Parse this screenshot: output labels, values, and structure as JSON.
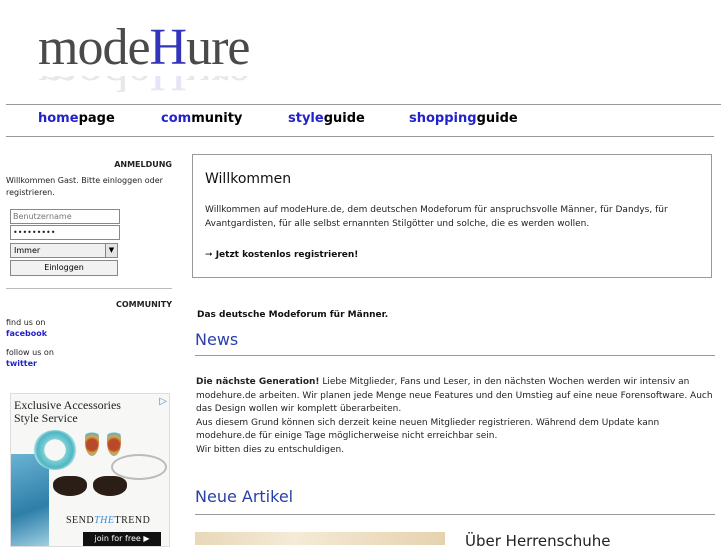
{
  "logo": {
    "pre": "mode",
    "accent": "H",
    "post": "ure"
  },
  "nav": [
    {
      "hl": "home",
      "rest": "page"
    },
    {
      "hl": "com",
      "rest": "munity"
    },
    {
      "hl": "style",
      "rest": "guide"
    },
    {
      "hl": "shopping",
      "rest": "guide"
    }
  ],
  "sidebar": {
    "login_title": "ANMELDUNG",
    "welcome_pre": "Willkommen Gast. Bitte ",
    "login_link": "einloggen",
    "welcome_mid": " oder ",
    "register_link": "registrieren",
    "welcome_post": ".",
    "username_placeholder": "Benutzername",
    "password_value": "•••••••••",
    "remember_value": "Immer",
    "login_button": "Einloggen",
    "community_title": "COMMUNITY",
    "find_us_label": "find us on",
    "facebook_link": "facebook",
    "follow_us_label": "follow us on",
    "twitter_link": "twitter"
  },
  "ad": {
    "title_line1": "Exclusive Accessories",
    "title_line2": "Style Service",
    "choices_icon": "adchoices-icon",
    "brand_pre": "SEND",
    "brand_em": "THE",
    "brand_post": "TREND",
    "join_label": "join for free ▶"
  },
  "welcome": {
    "heading": "Willkommen",
    "text": "Willkommen auf modeHure.de, dem deutschen Modeforum für anspruchsvolle Männer, für Dandys, für Avantgardisten, für alle selbst ernannten Stilgötter und solche, die es werden wollen.",
    "register_arrow": "➞",
    "register_label": "Jetzt kostenlos registrieren!"
  },
  "tagline": "Das deutsche Modeforum für Männer.",
  "news": {
    "heading": "News",
    "lead": "Die nächste Generation!",
    "p1": " Liebe Mitglieder, Fans und Leser, in den nächsten Wochen werden wir intensiv an modehure.de arbeiten. Wir planen jede Menge neue Features und den Umstieg auf eine neue Forensoftware. Auch das Design wollen wir komplett überarbeiten.",
    "p2": "Aus diesem Grund können sich derzeit keine neuen Mitglieder registrieren. Während dem Update kann modehure.de für einige Tage möglicherweise nicht erreichbar sein.",
    "p3": "Wir bitten dies zu entschuldigen."
  },
  "articles": {
    "heading": "Neue Artikel",
    "first_title": "Über Herrenschuhe"
  }
}
